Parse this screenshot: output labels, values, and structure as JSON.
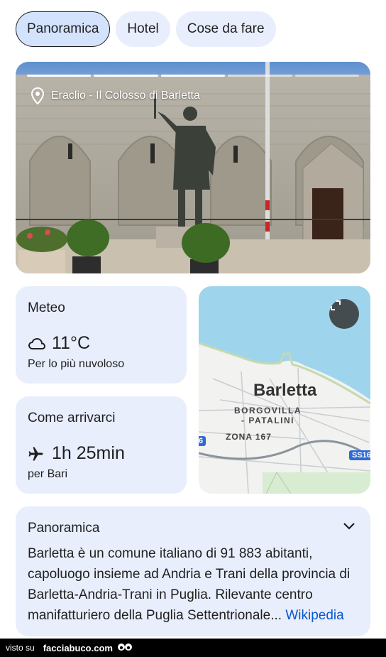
{
  "tabs": [
    {
      "label": "Panoramica",
      "active": true
    },
    {
      "label": "Hotel",
      "active": false
    },
    {
      "label": "Cose da fare",
      "active": false
    }
  ],
  "hero": {
    "place_label": "Eraclio - Il Colosso di Barletta",
    "progress": {
      "segments": 5,
      "current": 3
    },
    "icon": "location-pin-icon"
  },
  "weather": {
    "title": "Meteo",
    "icon": "cloud-icon",
    "temperature": "11°C",
    "condition": "Per lo più nuvoloso"
  },
  "travel": {
    "title": "Come arrivarci",
    "icon": "airplane-icon",
    "duration": "1h 25min",
    "destination": "per Bari"
  },
  "map": {
    "city": "Barletta",
    "neighborhood_line1": "BORGOVILLA",
    "neighborhood_line2": "- PATALINI",
    "zone": "ZONA 167",
    "road_right": "SS16",
    "road_left": "6",
    "expand_icon": "expand-icon"
  },
  "overview": {
    "title": "Panoramica",
    "text": "Barletta è un comune italiano di 91 883 abitanti, capoluogo insieme ad Andria e Trani della provincia di Barletta-Andria-Trani in Puglia. Rilevante centro manifatturiero della Puglia Settentrionale...",
    "link": "Wikipedia",
    "icon": "chevron-down-icon"
  },
  "footer": {
    "prefix": "visto su",
    "brand": "facciabuco.com"
  },
  "colors": {
    "card_bg": "#e8eefb",
    "active_chip_bg": "#d3e3fd",
    "link": "#0b57d0",
    "map_sea": "#9ed4ec",
    "map_land": "#f2f2f0"
  }
}
